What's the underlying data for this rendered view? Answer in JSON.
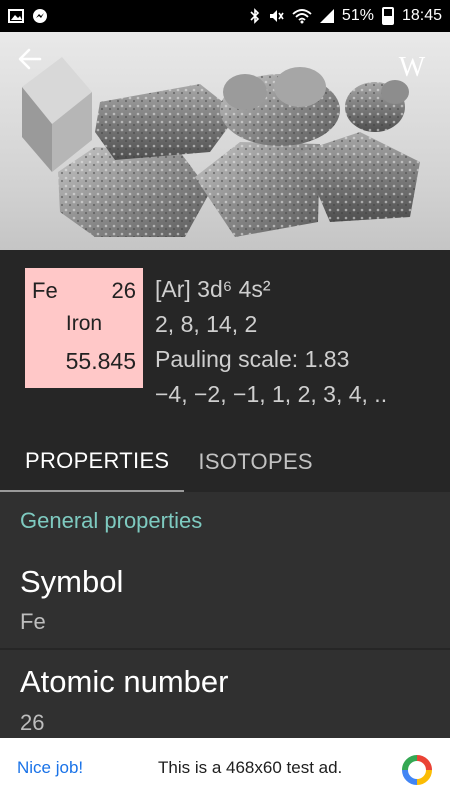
{
  "status_bar": {
    "battery": "51%",
    "time": "18:45",
    "left_icons": [
      "gallery-icon",
      "messenger-icon"
    ],
    "right_icons": [
      "bluetooth-icon",
      "mute-icon",
      "wifi-icon",
      "signal-icon",
      "battery-icon"
    ]
  },
  "header": {
    "back_icon": "arrow-back-icon",
    "wiki_label": "W"
  },
  "element": {
    "symbol": "Fe",
    "atomic_number": "26",
    "name": "Iron",
    "mass": "55.845",
    "tile_color": "#ffc8c8",
    "electron_configuration": "[Ar] 3d⁶ 4s²",
    "electrons_per_shell": "2, 8, 14, 2",
    "electronegativity": "Pauling scale: 1.83",
    "oxidation_states": "−4, −2, −1, 1, 2, 3, 4, .."
  },
  "tabs": [
    {
      "label": "PROPERTIES",
      "active": true
    },
    {
      "label": "ISOTOPES",
      "active": false
    }
  ],
  "content": {
    "section_title": "General properties",
    "accent_color": "#7ecac0",
    "properties": [
      {
        "label": "Symbol",
        "value": "Fe"
      },
      {
        "label": "Atomic number",
        "value": "26"
      }
    ]
  },
  "ad": {
    "label": "Nice job!",
    "text": "This is a 468x60 test ad."
  }
}
